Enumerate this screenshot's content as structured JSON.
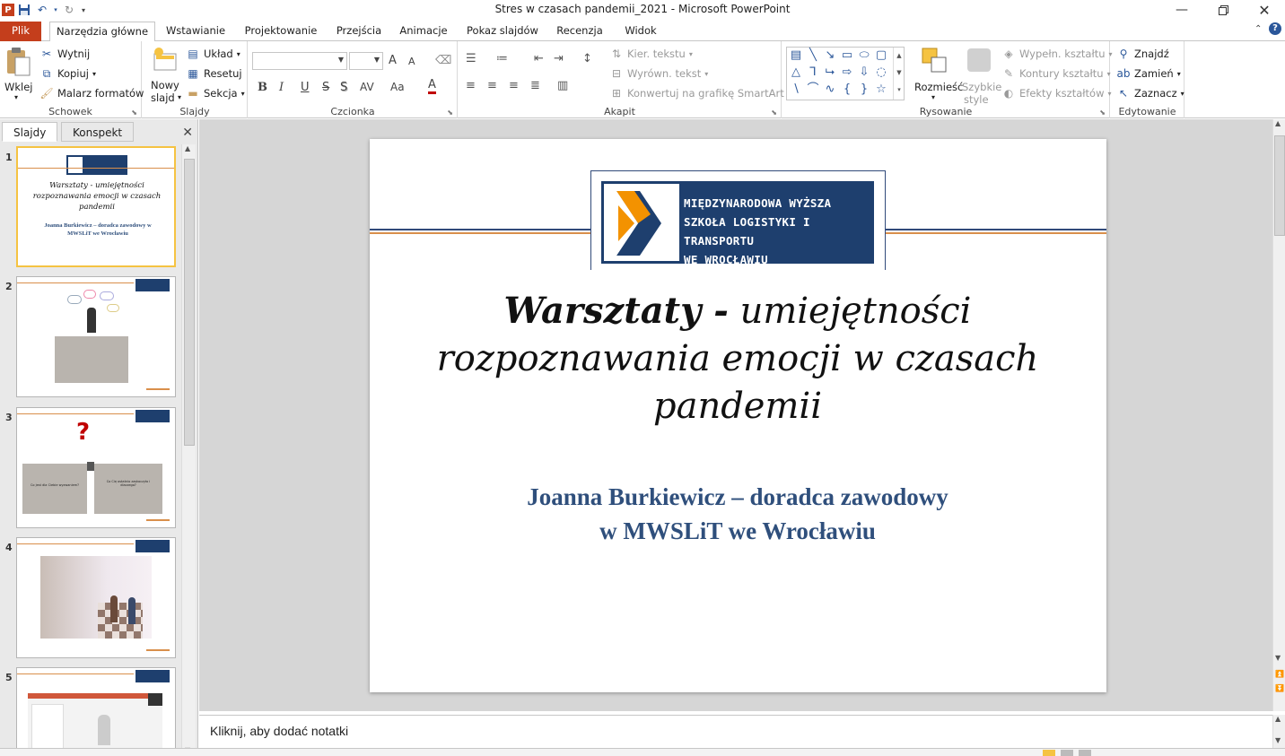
{
  "window": {
    "title": "Stres w czasach pandemii_2021  -  Microsoft PowerPoint",
    "controls": [
      "minimize",
      "restore",
      "close"
    ]
  },
  "tabs": [
    {
      "label": "Plik"
    },
    {
      "label": "Narzędzia główne"
    },
    {
      "label": "Wstawianie"
    },
    {
      "label": "Projektowanie"
    },
    {
      "label": "Przejścia"
    },
    {
      "label": "Animacje"
    },
    {
      "label": "Pokaz slajdów"
    },
    {
      "label": "Recenzja"
    },
    {
      "label": "Widok"
    }
  ],
  "ribbon": {
    "clipboard": {
      "label": "Schowek",
      "paste": "Wklej",
      "cut": "Wytnij",
      "copy": "Kopiuj",
      "format_painter": "Malarz formatów"
    },
    "slides": {
      "label": "Slajdy",
      "new_slide_1": "Nowy",
      "new_slide_2": "slajd",
      "layout": "Układ",
      "reset": "Resetuj",
      "section": "Sekcja"
    },
    "font": {
      "label": "Czcionka",
      "bold": "B",
      "italic": "I",
      "underline": "U",
      "strike": "S",
      "spacing": "AV",
      "case": "Aa",
      "color": "A",
      "grow": "A",
      "shrink": "A"
    },
    "paragraph": {
      "label": "Akapit",
      "text_direction": "Kier. tekstu",
      "align_text": "Wyrówn. tekst",
      "smartart": "Konwertuj na grafikę SmartArt"
    },
    "drawing": {
      "label": "Rysowanie",
      "arrange": "Rozmieść",
      "quick_styles_1": "Szybkie",
      "quick_styles_2": "style",
      "shape_fill": "Wypełn. kształtu",
      "shape_outline": "Kontury kształtu",
      "shape_effects": "Efekty kształtów"
    },
    "editing": {
      "label": "Edytowanie",
      "find": "Znajdź",
      "replace": "Zamień",
      "select": "Zaznacz"
    }
  },
  "left_pane": {
    "tabs": [
      "Slajdy",
      "Konspekt"
    ],
    "thumbnails": [
      {
        "num": "1",
        "title": "Warsztaty - umiejętności rozpoznawania emocji w czasach pandemii",
        "subtitle": "Joanna Burkiewicz – doradca zawodowy w MWSLiT we Wrocławiu"
      },
      {
        "num": "2"
      },
      {
        "num": "3",
        "caption_left": "Co jest dla Ciebie wyzwaniem?",
        "caption_right": "Co Cię ostatnio zaskoczyło i dlaczego?"
      },
      {
        "num": "4"
      },
      {
        "num": "5"
      }
    ]
  },
  "slide": {
    "logo_lines": [
      "MIĘDZYNARODOWA WYŻSZA",
      "SZKOŁA LOGISTYKI I TRANSPORTU",
      "WE WROCŁAWIU"
    ],
    "title_bold": "Warsztaty -",
    "title_rest": " umiejętności rozpoznawania emocji w czasach pandemii",
    "subtitle_line1": "Joanna Burkiewicz – doradca zawodowy",
    "subtitle_line2": "w MWSLiT we Wrocławiu"
  },
  "notes": {
    "placeholder": "Kliknij, aby dodać notatki"
  },
  "colors": {
    "file_tab": "#c43e1c",
    "logo_blue": "#1e3f6e",
    "logo_orange": "#f39200",
    "subtitle_blue": "#2f4f7c",
    "accent_line": "#d98f4b"
  }
}
